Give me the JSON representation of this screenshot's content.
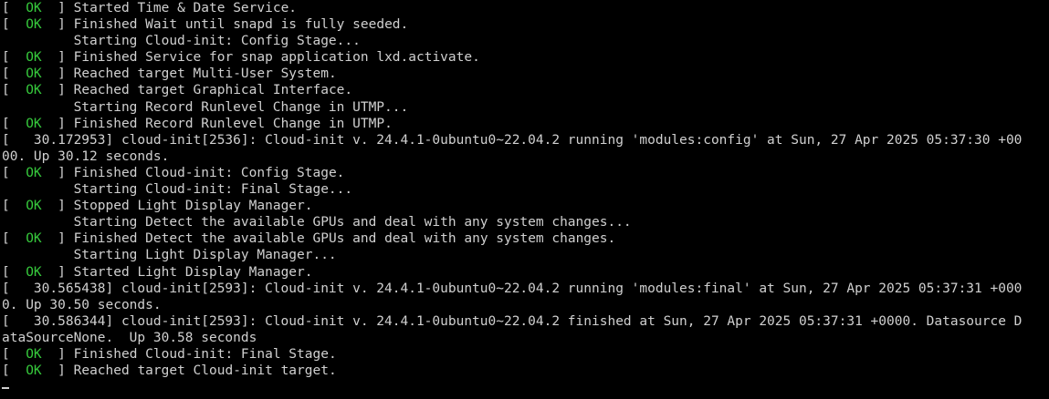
{
  "status_label": "OK",
  "lines": [
    {
      "kind": "ok",
      "text": " Started Time & Date Service."
    },
    {
      "kind": "ok",
      "text": " Finished Wait until snapd is fully seeded."
    },
    {
      "kind": "plain",
      "text": "         Starting Cloud-init: Config Stage..."
    },
    {
      "kind": "ok",
      "text": " Finished Service for snap application lxd.activate."
    },
    {
      "kind": "ok",
      "text": " Reached target Multi-User System."
    },
    {
      "kind": "ok",
      "text": " Reached target Graphical Interface."
    },
    {
      "kind": "plain",
      "text": "         Starting Record Runlevel Change in UTMP..."
    },
    {
      "kind": "ok",
      "text": " Finished Record Runlevel Change in UTMP."
    },
    {
      "kind": "plain",
      "text": "[   30.172953] cloud-init[2536]: Cloud-init v. 24.4.1-0ubuntu0~22.04.2 running 'modules:config' at Sun, 27 Apr 2025 05:37:30 +00"
    },
    {
      "kind": "plain",
      "text": "00. Up 30.12 seconds."
    },
    {
      "kind": "ok",
      "text": " Finished Cloud-init: Config Stage."
    },
    {
      "kind": "plain",
      "text": "         Starting Cloud-init: Final Stage..."
    },
    {
      "kind": "ok",
      "text": " Stopped Light Display Manager."
    },
    {
      "kind": "plain",
      "text": "         Starting Detect the available GPUs and deal with any system changes..."
    },
    {
      "kind": "ok",
      "text": " Finished Detect the available GPUs and deal with any system changes."
    },
    {
      "kind": "plain",
      "text": "         Starting Light Display Manager..."
    },
    {
      "kind": "ok",
      "text": " Started Light Display Manager."
    },
    {
      "kind": "plain",
      "text": "[   30.565438] cloud-init[2593]: Cloud-init v. 24.4.1-0ubuntu0~22.04.2 running 'modules:final' at Sun, 27 Apr 2025 05:37:31 +000"
    },
    {
      "kind": "plain",
      "text": "0. Up 30.50 seconds."
    },
    {
      "kind": "plain",
      "text": "[   30.586344] cloud-init[2593]: Cloud-init v. 24.4.1-0ubuntu0~22.04.2 finished at Sun, 27 Apr 2025 05:37:31 +0000. Datasource D"
    },
    {
      "kind": "plain",
      "text": "ataSourceNone.  Up 30.58 seconds"
    },
    {
      "kind": "ok",
      "text": " Finished Cloud-init: Final Stage."
    },
    {
      "kind": "ok",
      "text": " Reached target Cloud-init target."
    }
  ]
}
